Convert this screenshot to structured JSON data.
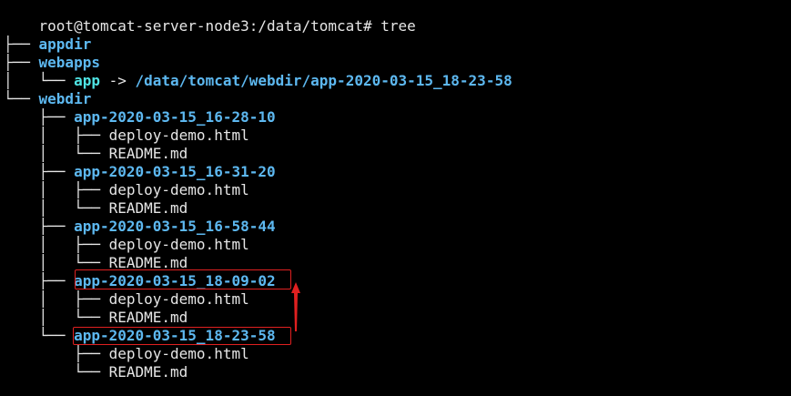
{
  "terminal": {
    "prompt": "root@tomcat-server-node3:/data/tomcat# tree",
    "root": ".",
    "tree": {
      "appdir": "appdir",
      "webapps": "webapps",
      "app_link_name": "app",
      "app_link_arrow": " -> ",
      "app_link_target": "/data/tomcat/webdir/app-2020-03-15_18-23-58",
      "webdir": "webdir",
      "releases": [
        {
          "name": "app-2020-03-15_16-28-10",
          "files": [
            "deploy-demo.html",
            "README.md"
          ]
        },
        {
          "name": "app-2020-03-15_16-31-20",
          "files": [
            "deploy-demo.html",
            "README.md"
          ]
        },
        {
          "name": "app-2020-03-15_16-58-44",
          "files": [
            "deploy-demo.html",
            "README.md"
          ]
        },
        {
          "name": "app-2020-03-15_18-09-02",
          "files": [
            "deploy-demo.html",
            "README.md"
          ]
        },
        {
          "name": "app-2020-03-15_18-23-58",
          "files": [
            "deploy-demo.html",
            "README.md"
          ]
        }
      ]
    }
  },
  "colors": {
    "background": "#000000",
    "directory": "#5db8f0",
    "symlink": "#4fe3e3",
    "file": "#e6e6e6",
    "annotation": "#e02020"
  }
}
